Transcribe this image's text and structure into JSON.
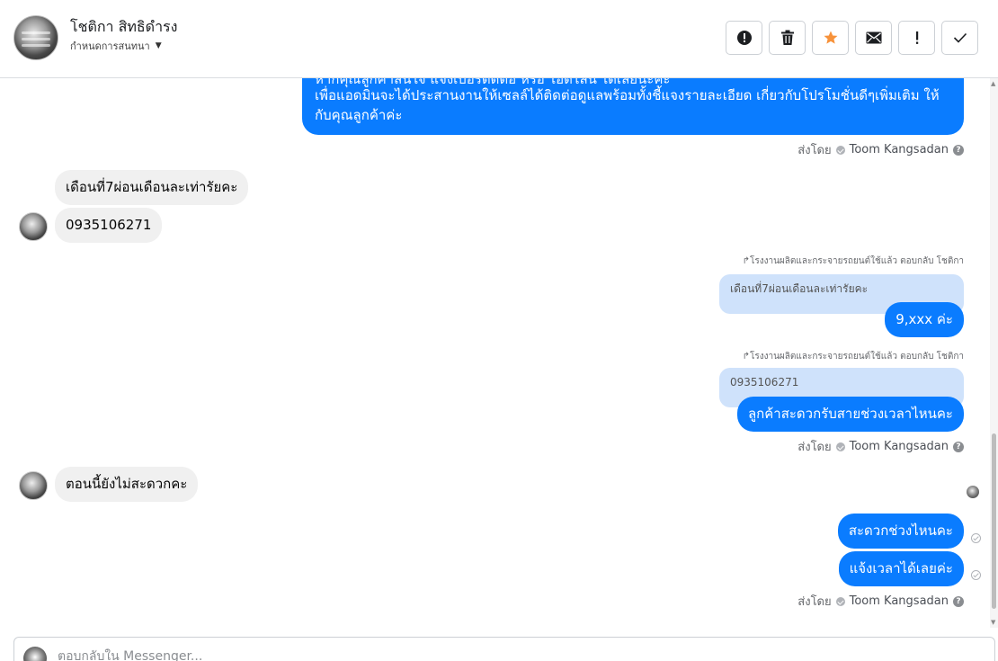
{
  "header": {
    "contact_name": "โชติกา สิทธิดำรง",
    "status_label": "กำหนดการสนทนา",
    "toolbar": [
      {
        "name": "mark-spam-button",
        "icon": "alert-circle-icon"
      },
      {
        "name": "delete-button",
        "icon": "trash-icon"
      },
      {
        "name": "star-button",
        "icon": "star-icon",
        "color": "#f7923a"
      },
      {
        "name": "email-button",
        "icon": "envelope-icon"
      },
      {
        "name": "important-button",
        "icon": "exclamation-icon"
      },
      {
        "name": "done-button",
        "icon": "check-icon"
      }
    ]
  },
  "messages": {
    "top": {
      "line0": "หากคุณลูกค้าสนใจ แจ้งเบอร์ติดต่อ หรือ ไอดีไลน์ ได้เลยนะคะ",
      "line1": "เพื่อแอดมินจะได้ประสานงานให้เซลล์ได้ติดต่อดูแลพร้อมทั้งชี้แจงรายละเอียด เกี่ยวกับโปรโมชั่นดีๆเพิ่มเติม ให้",
      "line2": "กับคุณลูกค้าค่ะ"
    },
    "sent_by_label": "ส่งโดย",
    "agent_name": "Toom Kangsadan",
    "in1": "เดือนที่7ผ่อนเดือนละเท่ารัยคะ",
    "in2": "0935106271",
    "reply_meta": "โรงงานผลิตและกระจายรถยนต์ใช้แล้ว ตอบกลับ โชติกา",
    "quote1": "เดือนที่7ผ่อนเดือนละเท่ารัยคะ",
    "out1": "9,xxx ค่ะ",
    "quote2": "0935106271",
    "out2": "ลูกค้าสะดวกรับสายช่วงเวลาไหนคะ",
    "in3": "ตอนนี้ยังไม่สะดวกคะ",
    "out3": "สะดวกช่วงไหนคะ",
    "out4": "แจ้งเวลาได้เลยค่ะ"
  },
  "composer": {
    "placeholder": "ตอบกลับใน Messenger..."
  },
  "colors": {
    "outgoing": "#0a7cff",
    "incoming": "#f0f0f0",
    "quote": "#cfe2fb",
    "star": "#f7923a"
  }
}
